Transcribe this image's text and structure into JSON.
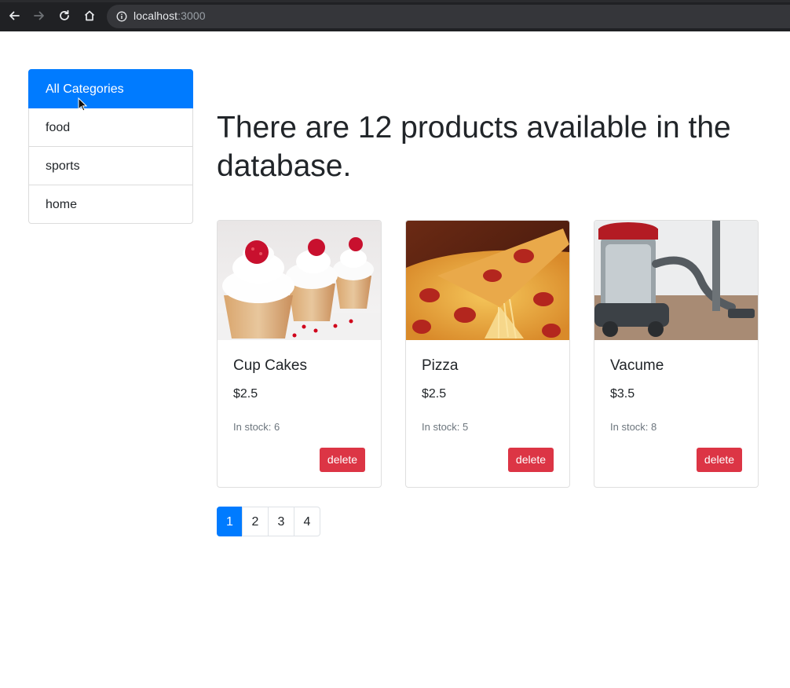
{
  "browser": {
    "url_host": "localhost",
    "url_port": ":3000",
    "icons": [
      "back-arrow-icon",
      "forward-arrow-icon",
      "reload-icon",
      "home-icon",
      "info-icon"
    ]
  },
  "sidebar": {
    "items": [
      {
        "label": "All Categories",
        "active": true
      },
      {
        "label": "food",
        "active": false
      },
      {
        "label": "sports",
        "active": false
      },
      {
        "label": "home",
        "active": false
      }
    ]
  },
  "main": {
    "heading": "There are 12 products available in the database."
  },
  "products": [
    {
      "name": "Cup Cakes",
      "price": "$2.5",
      "stock": "In stock: 6",
      "delete_label": "delete"
    },
    {
      "name": "Pizza",
      "price": "$2.5",
      "stock": "In stock: 5",
      "delete_label": "delete"
    },
    {
      "name": "Vacume",
      "price": "$3.5",
      "stock": "In stock: 8",
      "delete_label": "delete"
    }
  ],
  "pagination": {
    "pages": [
      "1",
      "2",
      "3",
      "4"
    ],
    "current": "1"
  },
  "colors": {
    "primary": "#007bff",
    "danger": "#dc3545",
    "chrome_bg": "#202124",
    "omnibox_bg": "#35363a"
  }
}
